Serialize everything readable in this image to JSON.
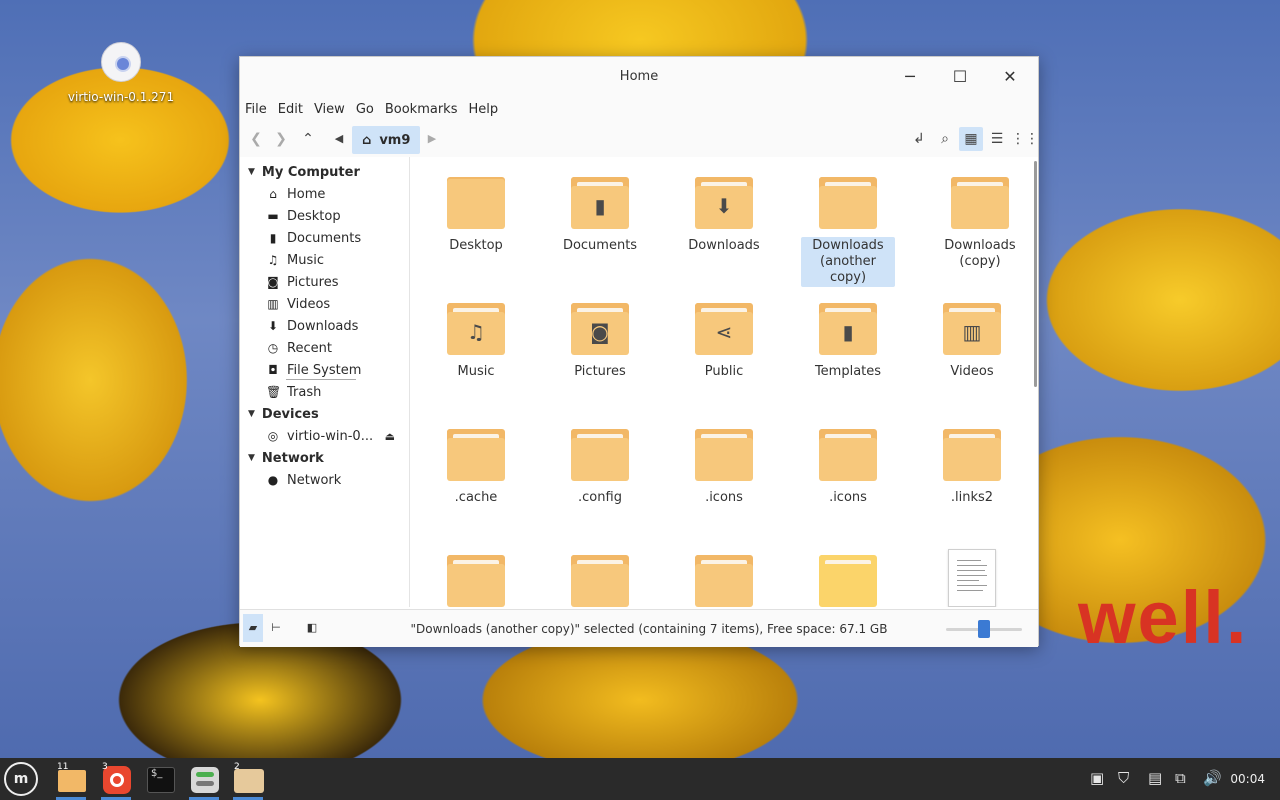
{
  "desktop": {
    "icon_label": "virtio-win-0.1.271",
    "wallpaper_text": "well."
  },
  "window": {
    "title": "Home",
    "controls": {
      "minimize": "─",
      "maximize": "☐",
      "close": "✕"
    }
  },
  "menu": [
    "File",
    "Edit",
    "View",
    "Go",
    "Bookmarks",
    "Help"
  ],
  "toolbar": {
    "breadcrumb": "vm9",
    "icons": [
      "back-icon",
      "forward-icon",
      "up-icon",
      "prev-location-icon",
      "home-icon",
      "next-location-icon",
      "location-toggle-icon",
      "search-icon",
      "grid-view-icon",
      "list-view-icon",
      "compact-view-icon"
    ]
  },
  "sidebar": {
    "my_computer": {
      "heading": "My Computer",
      "items": [
        {
          "label": "Home",
          "icon": "home-icon"
        },
        {
          "label": "Desktop",
          "icon": "desktop-icon"
        },
        {
          "label": "Documents",
          "icon": "document-icon"
        },
        {
          "label": "Music",
          "icon": "music-icon"
        },
        {
          "label": "Pictures",
          "icon": "camera-icon"
        },
        {
          "label": "Videos",
          "icon": "film-icon"
        },
        {
          "label": "Downloads",
          "icon": "download-icon"
        },
        {
          "label": "Recent",
          "icon": "clock-icon"
        },
        {
          "label": "File System",
          "icon": "drive-icon"
        },
        {
          "label": "Trash",
          "icon": "trash-icon"
        }
      ]
    },
    "devices": {
      "heading": "Devices",
      "items": [
        {
          "label": "virtio-win-0...",
          "icon": "disc-icon"
        }
      ]
    },
    "network": {
      "heading": "Network",
      "items": [
        {
          "label": "Network",
          "icon": "globe-icon"
        }
      ]
    }
  },
  "files": [
    {
      "name": "Desktop",
      "glyph": ""
    },
    {
      "name": "Documents",
      "glyph": "🖹"
    },
    {
      "name": "Downloads",
      "glyph": "⬇"
    },
    {
      "name": "Downloads (another copy)",
      "glyph": ""
    },
    {
      "name": "Downloads (copy)",
      "glyph": ""
    },
    {
      "name": "Music",
      "glyph": "♫"
    },
    {
      "name": "Pictures",
      "glyph": "📷"
    },
    {
      "name": "Public",
      "glyph": "⋖"
    },
    {
      "name": "Templates",
      "glyph": "🖹"
    },
    {
      "name": "Videos",
      "glyph": "🎞"
    },
    {
      "name": ".cache",
      "glyph": ""
    },
    {
      "name": ".config",
      "glyph": ""
    },
    {
      "name": ".icons",
      "glyph": ""
    },
    {
      "name": ".icons",
      "glyph": ""
    },
    {
      "name": ".links2",
      "glyph": ""
    }
  ],
  "status": {
    "text": "\"Downloads (another copy)\" selected (containing 7 items), Free space: 67.1 GB",
    "zoom_level_fraction": 0.5
  },
  "taskbar": {
    "badges": {
      "files": "11",
      "firefox": "3",
      "folder2": "2"
    },
    "clock": "00:04"
  },
  "colors": {
    "accent": "#cfe3f8",
    "folder": "#f7c87c",
    "taskbar": "#2a2a2a"
  }
}
